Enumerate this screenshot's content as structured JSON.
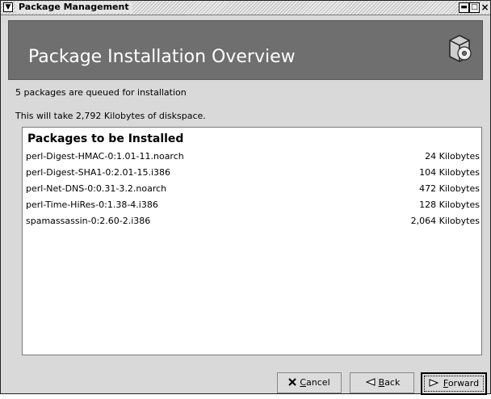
{
  "window": {
    "title": "Package Management",
    "menu_glyph": "▼",
    "min_glyph": "▬",
    "max_glyph": "□",
    "close_glyph": "×"
  },
  "header": {
    "title": "Package Installation Overview",
    "icon": "package-disk-icon"
  },
  "info": {
    "queued": "5 packages are queued for installation",
    "diskspace": "This will take 2,792 Kilobytes of diskspace."
  },
  "packages": {
    "heading": "Packages to be Installed",
    "rows": [
      {
        "name": "perl-Digest-HMAC-0:1.01-11.noarch",
        "size": "24 Kilobytes"
      },
      {
        "name": "perl-Digest-SHA1-0:2.01-15.i386",
        "size": "104 Kilobytes"
      },
      {
        "name": "perl-Net-DNS-0:0.31-3.2.noarch",
        "size": "472 Kilobytes"
      },
      {
        "name": "perl-Time-HiRes-0:1.38-4.i386",
        "size": "128 Kilobytes"
      },
      {
        "name": "spamassassin-0:2.60-2.i386",
        "size": "2,064 Kilobytes"
      }
    ]
  },
  "buttons": {
    "cancel": {
      "mnemonic": "C",
      "rest": "ancel",
      "icon": "cancel-x-icon"
    },
    "back": {
      "mnemonic": "B",
      "rest": "ack",
      "icon": "back-arrow-icon"
    },
    "forward": {
      "mnemonic": "F",
      "rest": "orward",
      "icon": "forward-arrow-icon"
    }
  }
}
